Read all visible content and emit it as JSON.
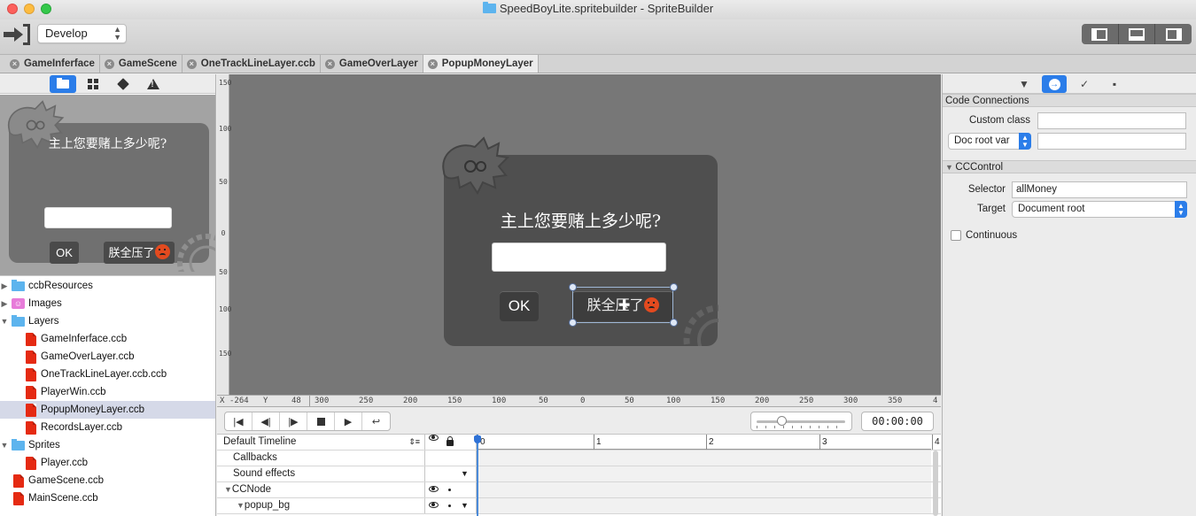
{
  "window": {
    "title": "SpeedBoyLite.spritebuilder - SpriteBuilder"
  },
  "toolbar": {
    "publish_icon": "publish-icon",
    "config_select": "Develop",
    "view_toggles": [
      "left-panel-toggle",
      "bottom-panel-toggle",
      "right-panel-toggle"
    ]
  },
  "tabs": [
    {
      "label": "GameInferface",
      "active": false
    },
    {
      "label": "GameScene",
      "active": false
    },
    {
      "label": "OneTrackLineLayer.ccb",
      "active": false
    },
    {
      "label": "GameOverLayer",
      "active": false
    },
    {
      "label": "PopupMoneyLayer",
      "active": true
    }
  ],
  "left_panel": {
    "tabs": [
      "folder-icon",
      "grid-icon",
      "cube-icon",
      "warning-icon"
    ],
    "preview": {
      "title": "主上您要赌上多少呢?",
      "ok_label": "OK",
      "bet_label": "朕全压了"
    },
    "tree": [
      {
        "label": "ccbResources",
        "type": "folder",
        "indent": 0,
        "disclosure": "▶"
      },
      {
        "label": "Images",
        "type": "images",
        "indent": 0,
        "disclosure": "▶"
      },
      {
        "label": "Layers",
        "type": "folder",
        "indent": 0,
        "disclosure": "▼"
      },
      {
        "label": "GameInferface.ccb",
        "type": "ccb",
        "indent": 1
      },
      {
        "label": "GameOverLayer.ccb",
        "type": "ccb",
        "indent": 1
      },
      {
        "label": "OneTrackLineLayer.ccb.ccb",
        "type": "ccb",
        "indent": 1
      },
      {
        "label": "PlayerWin.ccb",
        "type": "ccb",
        "indent": 1
      },
      {
        "label": "PopupMoneyLayer.ccb",
        "type": "ccb",
        "indent": 1,
        "selected": true
      },
      {
        "label": "RecordsLayer.ccb",
        "type": "ccb",
        "indent": 1
      },
      {
        "label": "Sprites",
        "type": "folder",
        "indent": 0,
        "disclosure": "▼"
      },
      {
        "label": "Player.ccb",
        "type": "ccb",
        "indent": 1
      },
      {
        "label": "GameScene.ccb",
        "type": "ccb",
        "indent": 0
      },
      {
        "label": "MainScene.ccb",
        "type": "ccb",
        "indent": 0
      }
    ]
  },
  "canvas": {
    "dialog_title": "主上您要赌上多少呢?",
    "ok_label": "OK",
    "bet_label": "朕全压了",
    "vertical_ruler": [
      "150",
      "100",
      "50",
      "0",
      "50",
      "100",
      "150"
    ],
    "horizontal_ruler": {
      "x_label": "X",
      "x_value": "-264",
      "y_label": "Y",
      "y_value": "48",
      "ticks": [
        "300",
        "250",
        "200",
        "150",
        "100",
        "50",
        "0",
        "50",
        "100",
        "150",
        "200",
        "250",
        "300",
        "350",
        "4"
      ]
    }
  },
  "transport": {
    "buttons": [
      "skip-to-start-icon",
      "step-back-icon",
      "step-forward-icon",
      "stop-icon",
      "play-icon",
      "loop-icon"
    ],
    "zoom_level": 0.28,
    "time": "00:00:00"
  },
  "timeline": {
    "selector": "Default Timeline",
    "ruler_marks": [
      "0",
      "1",
      "2",
      "3",
      "4"
    ],
    "rows": [
      {
        "label": "Callbacks"
      },
      {
        "label": "Sound effects"
      },
      {
        "label": "CCNode"
      },
      {
        "label": "popup_bg"
      }
    ]
  },
  "right_panel": {
    "tabs": [
      "node-properties-icon",
      "code-connections-icon",
      "physics-icon",
      "templates-icon"
    ],
    "code_connections": {
      "header": "Code Connections",
      "custom_class_label": "Custom class",
      "custom_class_value": "",
      "doc_root_var": "Doc root var",
      "doc_root_value": ""
    },
    "cc_control": {
      "header": "CCControl",
      "selector_label": "Selector",
      "selector_value": "allMoney",
      "target_label": "Target",
      "target_value": "Document root",
      "continuous_label": "Continuous",
      "continuous_checked": false
    }
  }
}
